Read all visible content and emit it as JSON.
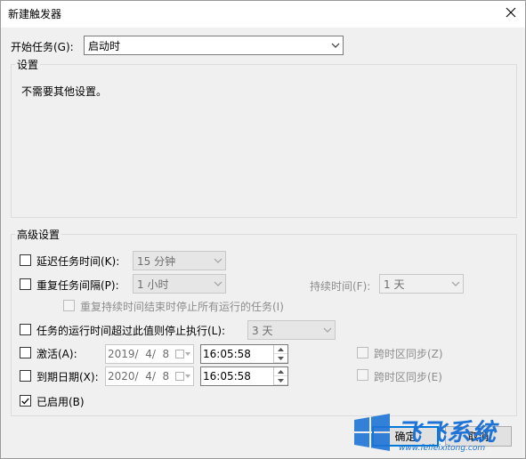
{
  "window": {
    "title": "新建触发器"
  },
  "start_task": {
    "label": "开始任务(G):",
    "value": "启动时"
  },
  "settings_group": {
    "label": "设置",
    "message": "不需要其他设置。"
  },
  "advanced": {
    "label": "高级设置",
    "delay": {
      "label": "延迟任务时间(K):",
      "value": "15 分钟",
      "checked": false
    },
    "repeat": {
      "label": "重复任务间隔(P):",
      "value": "1 小时",
      "checked": false
    },
    "duration": {
      "label": "持续时间(F):",
      "value": "1 天"
    },
    "stop_all": {
      "label": "重复持续时间结束时停止所有运行的任务(I)",
      "checked": false
    },
    "stop_longer": {
      "label": "任务的运行时间超过此值则停止执行(L):",
      "value": "3 天",
      "checked": false
    },
    "activate": {
      "label": "激活(A):",
      "date": "2019/  4/  8",
      "time": "16:05:58",
      "checked": false,
      "sync_label": "跨时区同步(Z)"
    },
    "expire": {
      "label": "到期日期(X):",
      "date": "2020/  4/  8",
      "time": "16:05:58",
      "checked": false,
      "sync_label": "跨时区同步(E)"
    },
    "enabled": {
      "label": "已启用(B)",
      "checked": true
    }
  },
  "buttons": {
    "ok": "确定",
    "cancel": "取消"
  },
  "watermark": {
    "logo_text": "飞飞系统",
    "url": "www.feifeixitong.com"
  },
  "colors": {
    "accent": "#0078d7",
    "watermark_blue": "#1e73d6"
  },
  "icons": [
    "close-icon",
    "chevron-down-icon",
    "checkmark-icon",
    "calendar-icon",
    "spin-up-icon",
    "spin-down-icon",
    "windows-logo-icon"
  ]
}
